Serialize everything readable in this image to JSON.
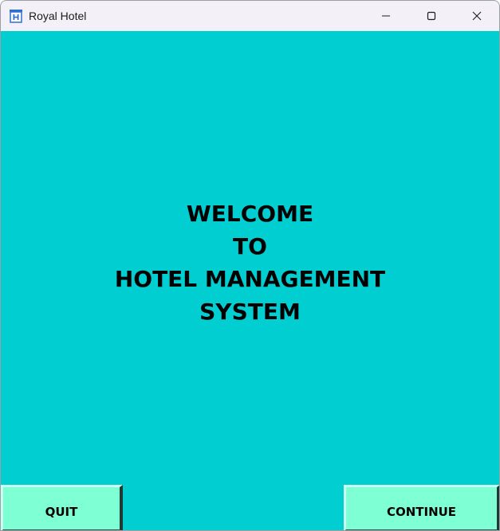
{
  "window": {
    "title": "Royal Hotel",
    "icon": "hotel-app-icon",
    "controls": {
      "minimize_icon": "minimize-icon",
      "maximize_icon": "maximize-icon",
      "close_icon": "close-icon"
    }
  },
  "welcome": {
    "lines": [
      "WELCOME",
      "TO",
      "HOTEL MANAGEMENT",
      "SYSTEM"
    ]
  },
  "buttons": {
    "quit_label": "QUIT",
    "continue_label": "CONTINUE"
  },
  "colors": {
    "background": "#00ced1",
    "button_bg": "#7fffd4",
    "titlebar_bg": "#f3f1f7",
    "text": "#000000"
  }
}
